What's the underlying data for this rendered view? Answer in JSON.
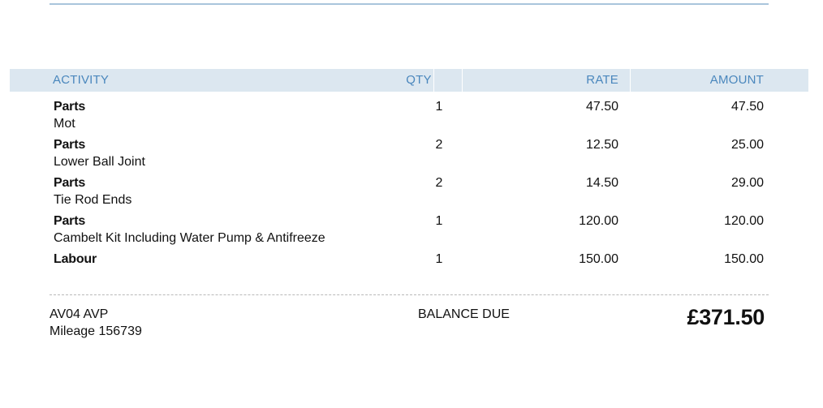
{
  "table": {
    "headers": {
      "activity": "ACTIVITY",
      "qty": "QTY",
      "rate": "RATE",
      "amount": "AMOUNT"
    },
    "rows": [
      {
        "title": "Parts",
        "description": "Mot",
        "qty": "1",
        "rate": "47.50",
        "amount": "47.50"
      },
      {
        "title": "Parts",
        "description": "Lower Ball Joint",
        "qty": "2",
        "rate": "12.50",
        "amount": "25.00"
      },
      {
        "title": "Parts",
        "description": "Tie Rod Ends",
        "qty": "2",
        "rate": "14.50",
        "amount": "29.00"
      },
      {
        "title": "Parts",
        "description": "Cambelt Kit Including Water Pump & Antifreeze",
        "qty": "1",
        "rate": "120.00",
        "amount": "120.00"
      },
      {
        "title": "Labour",
        "description": "",
        "qty": "1",
        "rate": "150.00",
        "amount": "150.00"
      }
    ]
  },
  "footer": {
    "registration": "AV04 AVP",
    "mileage": "Mileage 156739",
    "balance_label": "BALANCE DUE",
    "balance_amount": "£371.50"
  },
  "colors": {
    "header_bg": "#dce7f0",
    "header_text": "#4a87bd",
    "rule": "#a9c5dc"
  }
}
